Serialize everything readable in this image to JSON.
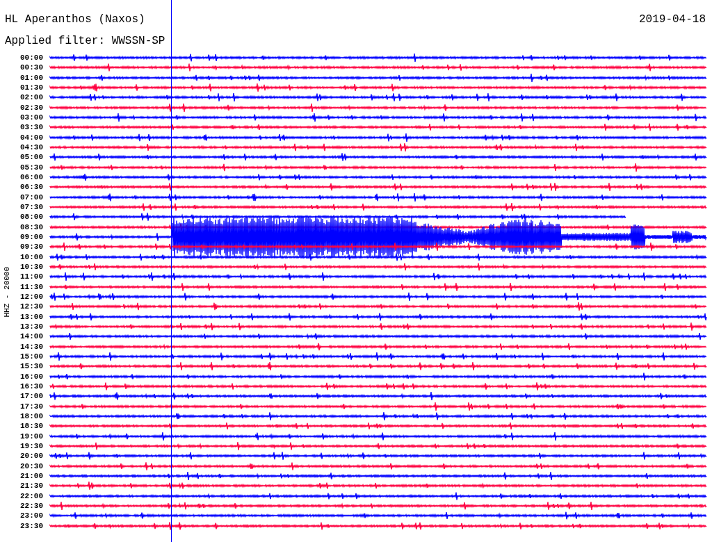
{
  "header": {
    "title": "HL Aperanthos (Naxos)",
    "date": "2019-04-18",
    "filter": "Applied filter: WWSSN-SP"
  },
  "axis_label": "HHZ - 20000",
  "traces": [
    {
      "time": "00:00",
      "color": "#0000ff"
    },
    {
      "time": "00:30",
      "color": "#ff0040"
    },
    {
      "time": "01:00",
      "color": "#0000ff"
    },
    {
      "time": "01:30",
      "color": "#ff0040"
    },
    {
      "time": "02:00",
      "color": "#0000ff"
    },
    {
      "time": "02:30",
      "color": "#ff0040"
    },
    {
      "time": "03:00",
      "color": "#0000ff"
    },
    {
      "time": "03:30",
      "color": "#ff0040"
    },
    {
      "time": "04:00",
      "color": "#0000ff"
    },
    {
      "time": "04:30",
      "color": "#ff0040"
    },
    {
      "time": "05:00",
      "color": "#0000ff"
    },
    {
      "time": "05:30",
      "color": "#ff0040"
    },
    {
      "time": "06:00",
      "color": "#0000ff"
    },
    {
      "time": "06:30",
      "color": "#ff0040"
    },
    {
      "time": "07:00",
      "color": "#0000ff"
    },
    {
      "time": "07:30",
      "color": "#ff0040"
    },
    {
      "time": "08:00",
      "color": "#0000ff"
    },
    {
      "time": "08:30",
      "color": "#ff0040"
    },
    {
      "time": "09:00",
      "color": "#0000ff"
    },
    {
      "time": "09:30",
      "color": "#ff0040"
    },
    {
      "time": "10:00",
      "color": "#0000ff"
    },
    {
      "time": "10:30",
      "color": "#ff0040"
    },
    {
      "time": "11:00",
      "color": "#0000ff"
    },
    {
      "time": "11:30",
      "color": "#ff0040"
    },
    {
      "time": "12:00",
      "color": "#0000ff"
    },
    {
      "time": "12:30",
      "color": "#ff0040"
    },
    {
      "time": "13:00",
      "color": "#0000ff"
    },
    {
      "time": "13:30",
      "color": "#ff0040"
    },
    {
      "time": "14:00",
      "color": "#0000ff"
    },
    {
      "time": "14:30",
      "color": "#ff0040"
    },
    {
      "time": "15:00",
      "color": "#0000ff"
    },
    {
      "time": "15:30",
      "color": "#ff0040"
    },
    {
      "time": "16:00",
      "color": "#0000ff"
    },
    {
      "time": "16:30",
      "color": "#ff0040"
    },
    {
      "time": "17:00",
      "color": "#0000ff"
    },
    {
      "time": "17:30",
      "color": "#ff0040"
    },
    {
      "time": "18:00",
      "color": "#0000ff"
    },
    {
      "time": "18:30",
      "color": "#ff0040"
    },
    {
      "time": "19:00",
      "color": "#0000ff"
    },
    {
      "time": "19:30",
      "color": "#ff0040"
    },
    {
      "time": "20:00",
      "color": "#0000ff"
    },
    {
      "time": "20:30",
      "color": "#ff0040"
    },
    {
      "time": "21:00",
      "color": "#0000ff"
    },
    {
      "time": "21:30",
      "color": "#ff0040"
    },
    {
      "time": "22:00",
      "color": "#0000ff"
    },
    {
      "time": "22:30",
      "color": "#ff0040"
    },
    {
      "time": "23:00",
      "color": "#0000ff"
    },
    {
      "time": "23:30",
      "color": "#ff0040"
    }
  ]
}
